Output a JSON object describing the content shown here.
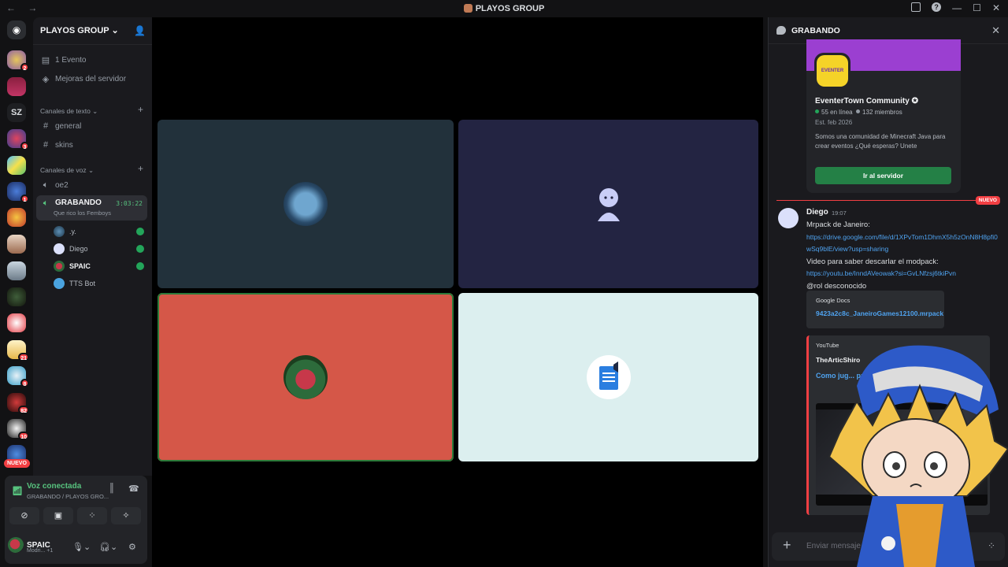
{
  "titlebar": {
    "title": "PLAYOS GROUP",
    "nav": "← →"
  },
  "rail": {
    "nuevo": "NUEVO",
    "sz": "SZ",
    "badges": [
      "2",
      "3",
      "1",
      "21",
      "8",
      "82",
      "10"
    ]
  },
  "sidebar": {
    "server_name": "PLAYOS GROUP",
    "items": [
      {
        "label": "1 Evento"
      },
      {
        "label": "Mejoras del servidor"
      }
    ],
    "text_category": "Canales de texto",
    "text_channels": [
      "general",
      "skins"
    ],
    "voice_category": "Canales de voz",
    "voice_channels": [
      {
        "name": "oe2"
      },
      {
        "name": "GRABANDO",
        "timer": "3:03:22",
        "status": "Que rico los Femboys"
      }
    ],
    "members": [
      ".y.",
      "Diego",
      "SPAIC",
      "TTS Bot"
    ]
  },
  "panel": {
    "voice_connected": "Voz conectada",
    "voice_sub": "GRABANDO / PLAYOS GRO...",
    "username": "SPAIC",
    "user_status": "Modri...",
    "plus": "+1"
  },
  "right_panel": {
    "header": "GRABANDO",
    "invite": {
      "server": "EventerTown Community",
      "online": "55 en línea",
      "members": "132 miembros",
      "est": "Est. feb 2026",
      "desc": "Somos una comunidad de Minecraft Java para crear eventos ¿Qué esperas? Unete",
      "button": "Ir al servidor"
    },
    "new_tag": "NUEVO",
    "message": {
      "author": "Diego",
      "time": "19:07",
      "line1": "Mrpack de Janeiro:",
      "link1": "https://drive.google.com/file/d/1XPvTom1DhmX5h5zOnN8H8pfi0wSq9blE/view?usp=sharing",
      "line2": "Video para saber descarlar el modpack:",
      "link2": "https://youtu.be/InndAVeowak?si=GvLNfzsj6tkiPvn",
      "line3": "@rol desconocido",
      "embed1_provider": "Google Docs",
      "embed1_title": "9423a2c8c_JaneiroGames12100.mrpack",
      "embed2_provider": "YouTube",
      "embed2_author": "TheArticShiro",
      "embed2_title": "Como jug... premium ..."
    },
    "composer_placeholder": "Enviar mensaje a GI..."
  },
  "colors": {
    "accent_green": "#23a55a",
    "danger": "#f23f43",
    "link": "#4fa3f0"
  }
}
